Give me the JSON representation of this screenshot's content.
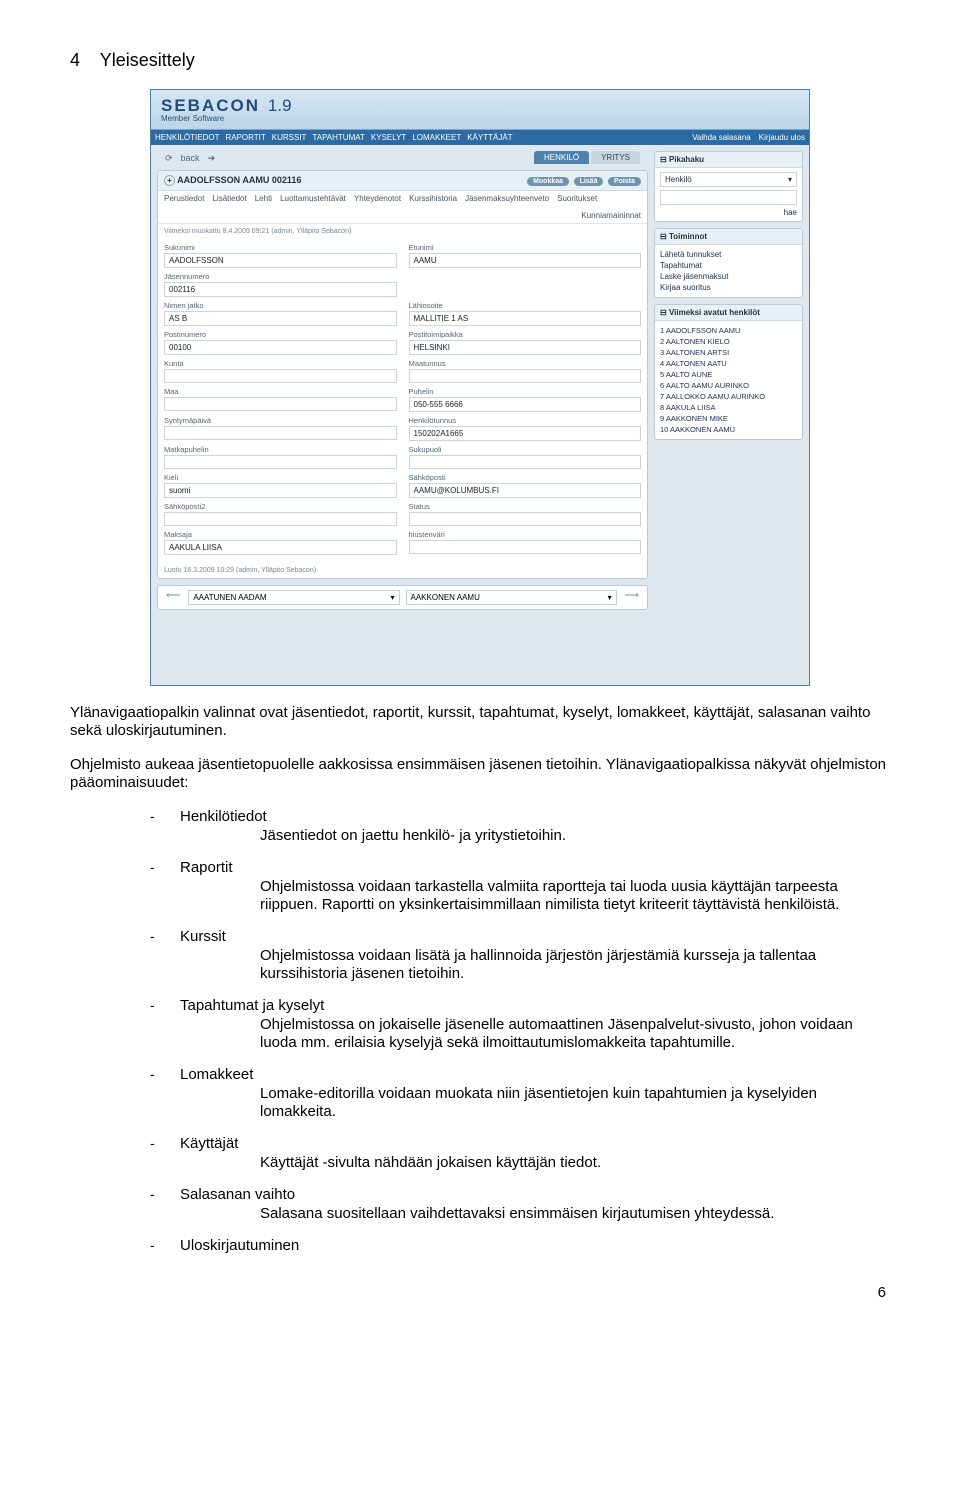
{
  "doc": {
    "heading_number": "4",
    "heading_text": "Yleisesittely",
    "intro": "Ylänavigaatiopalkin valinnat ovat jäsentiedot, raportit, kurssit, tapahtumat, kyselyt, lomakkeet, käyttäjät, salasanan vaihto sekä uloskirjautuminen.",
    "para2": "Ohjelmisto aukeaa jäsentietopuolelle aakkosissa ensimmäisen jäsenen tietoihin. Ylänavigaatiopalkissa näkyvät ohjelmiston pääominaisuudet:",
    "items": [
      {
        "name": "Henkilötiedot",
        "desc": "Jäsentiedot on jaettu henkilö- ja yritystietoihin."
      },
      {
        "name": "Raportit",
        "desc": "Ohjelmistossa voidaan tarkastella valmiita raportteja tai luoda uusia käyttäjän tarpeesta riippuen. Raportti on yksinkertaisimmillaan nimilista tietyt kriteerit täyttävistä henkilöistä."
      },
      {
        "name": "Kurssit",
        "desc": "Ohjelmistossa voidaan lisätä ja hallinnoida järjestön järjestämiä kursseja ja tallentaa kurssihistoria jäsenen tietoihin."
      },
      {
        "name": "Tapahtumat ja kyselyt",
        "desc": "Ohjelmistossa on jokaiselle jäsenelle automaattinen Jäsenpalvelut-sivusto, johon voidaan luoda mm. erilaisia kyselyjä sekä ilmoittautumislomakkeita tapahtumille."
      },
      {
        "name": "Lomakkeet",
        "desc": "Lomake-editorilla voidaan muokata niin jäsentietojen kuin tapahtumien ja kyselyiden lomakkeita."
      },
      {
        "name": "Käyttäjät",
        "desc": "Käyttäjät -sivulta nähdään jokaisen käyttäjän tiedot."
      },
      {
        "name": "Salasanan vaihto",
        "desc": "Salasana suositellaan vaihdettavaksi ensimmäisen kirjautumisen yhteydessä."
      },
      {
        "name": "Uloskirjautuminen",
        "desc": ""
      }
    ],
    "page_number": "6"
  },
  "shot": {
    "brand": "SEBACON",
    "version": "1.9",
    "brand_sub": "Member Software",
    "topnav": [
      "HENKILÖTIEDOT",
      "RAPORTIT",
      "KURSSIT",
      "TAPAHTUMAT",
      "KYSELYT",
      "LOMAKKEET",
      "KÄYTTÄJÄT"
    ],
    "topnav_right": [
      "Vaihda salasana",
      "Kirjaudu ulos"
    ],
    "back": "back",
    "tabs_active": "HENKILÖ",
    "tabs_inactive": "YRITYS",
    "card_title": "AADOLFSSON AAMU 002116",
    "subtabs": [
      "Perustiedot",
      "Lisätiedot",
      "Lehti",
      "Luottamustehtävät",
      "Yhteydenotot",
      "Kurssihistoria",
      "Jäsenmaksuyhteenveto",
      "Suoritukset"
    ],
    "subtabs_right": "Kunniamaininnat",
    "meta": "Viimeksi muokattu 8.4.2009 09:21 (admin, Ylläpito Sebacon)",
    "actions": [
      "Muokkaa",
      "Lisää",
      "Poista"
    ],
    "fields": [
      [
        "Sukunimi",
        "AADOLFSSON",
        "Etunimi",
        "AAMU"
      ],
      [
        "Jäsennumero",
        "002116",
        "",
        ""
      ],
      [
        "Nimen jatko",
        "AS B",
        "Lähiosoite",
        "MALLITIE 1 AS"
      ],
      [
        "Postinumero",
        "00100",
        "Postitoimipaikka",
        "HELSINKI"
      ],
      [
        "Kunta",
        "",
        "Maatunnus",
        ""
      ],
      [
        "Maa",
        "",
        "Puhelin",
        "050-555 6666"
      ],
      [
        "Syntymäpäivä",
        "",
        "Henkilötunnus",
        "150202A1665"
      ],
      [
        "Matkapuhelin",
        "",
        "Sukupuoli",
        ""
      ],
      [
        "Kieli",
        "suomi",
        "Sähköposti",
        "AAMU@KOLUMBUS.FI"
      ],
      [
        "Sähköposti2",
        "",
        "Status",
        ""
      ],
      [
        "Maksaja",
        "AAKULA LIISA",
        "hiustenväri",
        ""
      ]
    ],
    "footer_meta": "Luotu 16.3.2009 10:29 (admin, Ylläpito Sebacon)",
    "prev_person": "AAATUNEN AADAM",
    "next_person": "AAKKONEN AAMU",
    "side_quick_title": "Pikahaku",
    "side_quick_sel": "Henkilö",
    "side_quick_btn": "hae",
    "side_actions_title": "Toiminnot",
    "side_actions": [
      "Lähetä tunnukset",
      "Tapahtumat",
      "Laske jäsenmaksut",
      "Kirjaa suoritus"
    ],
    "side_recent_title": "Viimeksi avatut henkilöt",
    "side_recent": [
      "1 AADOLFSSON AAMU",
      "2 AALTONEN KIELO",
      "3 AALTONEN ARTSI",
      "4 AALTONEN AATU",
      "5 AALTO AUNE",
      "6 AALTO AAMU AURINKO",
      "7 AALLOKKO AAMU AURINKO",
      "8 AAKULA LIISA",
      "9 AAKKONEN MIKE",
      "10 AAKKONEN AAMU"
    ]
  }
}
